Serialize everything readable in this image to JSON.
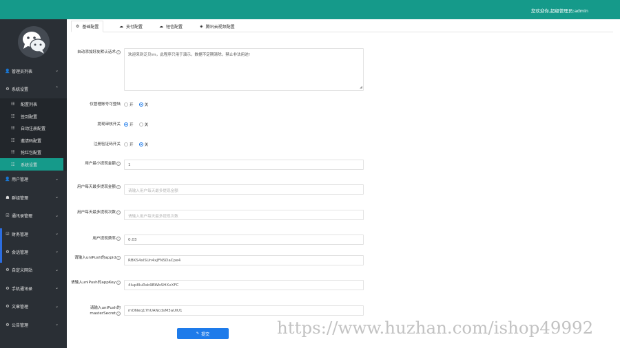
{
  "header": {
    "welcome": "您欢迎你,超级管理员:admin",
    "color": "#159a8a"
  },
  "sidebar": {
    "items": [
      {
        "label": "管理员列表",
        "icon": "user-icon",
        "glyph": "👤",
        "chev": "⌄"
      },
      {
        "label": "系统设置",
        "icon": "gear-icon",
        "glyph": "⚙",
        "chev": "⌃",
        "children": [
          {
            "label": "配置列表",
            "glyph": "☷"
          },
          {
            "label": "签到配置",
            "glyph": "☷"
          },
          {
            "label": "自动注册配置",
            "glyph": "☷"
          },
          {
            "label": "邀请码配置",
            "glyph": "☷"
          },
          {
            "label": "抢红包配置",
            "glyph": "☷"
          },
          {
            "label": "系统设置",
            "glyph": "☷",
            "active": true
          }
        ]
      },
      {
        "label": "用户管理",
        "icon": "user-icon",
        "glyph": "👤",
        "chev": "⌄"
      },
      {
        "label": "群组管理",
        "icon": "group-icon",
        "glyph": "☗",
        "chev": "⌄"
      },
      {
        "label": "通讯录管理",
        "icon": "edit-icon",
        "glyph": "☑",
        "chev": "⌄"
      },
      {
        "label": "财务管理",
        "icon": "edit-icon",
        "glyph": "☑",
        "chev": "⌄"
      },
      {
        "label": "会话管理",
        "icon": "gear-icon",
        "glyph": "⚙",
        "chev": "⌄"
      },
      {
        "label": "自定义网站",
        "icon": "gear-icon",
        "glyph": "⚙",
        "chev": "⌄"
      },
      {
        "label": "手机通讯录",
        "icon": "gear-icon",
        "glyph": "⚙",
        "chev": "⌄"
      },
      {
        "label": "文章管理",
        "icon": "gear-icon",
        "glyph": "⚙",
        "chev": "⌄"
      },
      {
        "label": "公告管理",
        "icon": "gear-icon",
        "glyph": "⚙",
        "chev": "⌄"
      }
    ]
  },
  "tabs": [
    {
      "label": "基础配置",
      "glyph": "⚙",
      "icon": "gear-icon",
      "active": true
    },
    {
      "label": "支付配置",
      "glyph": "☁",
      "icon": "cloud-icon"
    },
    {
      "label": "短信配置",
      "glyph": "☁",
      "icon": "cloud-icon"
    },
    {
      "label": "腾讯云视频配置",
      "glyph": "◈",
      "icon": "cube-icon"
    }
  ],
  "form": {
    "auto_friend_msg": {
      "label": "自动添加好友默认话术",
      "value": "欢迎来到泛贝im，此程序只用于演示，数据不定期清除，禁止非法用途!"
    },
    "admin_only_login": {
      "label": "仅管理账号可登陆",
      "on": "开",
      "off": "关",
      "selected": "off"
    },
    "withdraw_audit": {
      "label": "提现审核开关",
      "on": "开",
      "off": "关",
      "selected": "on"
    },
    "register_verify": {
      "label": "注册验证码开关",
      "on": "开",
      "off": "关",
      "selected": "off"
    },
    "min_withdraw": {
      "label": "用户最小提现金额",
      "value": "1"
    },
    "daily_max_amount": {
      "label": "用户每天最多提现金额",
      "placeholder": "请输入用户每天最多提现金额"
    },
    "daily_max_times": {
      "label": "用户每天最多提现次数",
      "placeholder": "请输入用户每天最多提现次数"
    },
    "withdraw_rate": {
      "label": "用户提现费率",
      "value": "0.03"
    },
    "unipush_appid": {
      "label": "请输入uniPush的appid",
      "value": "RBKS4xlSUn4xJFNSDaCpe4"
    },
    "unipush_appkey": {
      "label": "请输入uniPush的appKey",
      "value": "4Iup8luRsb9BWbSHXvXFC"
    },
    "unipush_secret": {
      "label": "请输入uniPush的masterSecret",
      "value": "mONeq17hUANcdsM3aUIU1"
    },
    "submit_label": "提交",
    "submit_icon": "✎",
    "accent": "#1e7bea"
  },
  "watermark": "https://www.huzhan.com/ishop49992"
}
